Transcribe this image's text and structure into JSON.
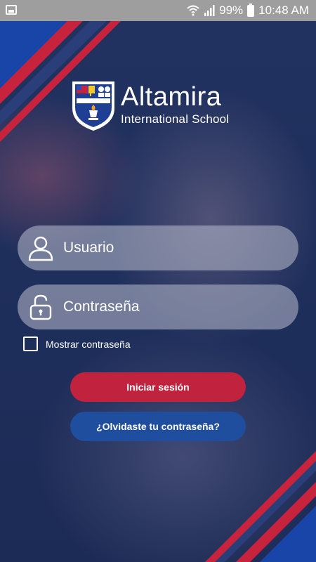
{
  "status_bar": {
    "battery": "99%",
    "time": "10:48 AM"
  },
  "logo": {
    "title": "Altamira",
    "subtitle": "International School",
    "shield_text": "Altamira"
  },
  "login": {
    "username_placeholder": "Usuario",
    "password_placeholder": "Contraseña",
    "show_password_label": "Mostrar contraseña",
    "login_button": "Iniciar sesión",
    "forgot_button": "¿Olvidaste tu contraseña?"
  },
  "colors": {
    "brand_red": "#c1223d",
    "brand_blue": "#1f4e9e",
    "background": "#1c2b55"
  },
  "icons": [
    "image-icon",
    "wifi-icon",
    "signal-icon",
    "battery-icon",
    "user-icon",
    "lock-icon"
  ]
}
